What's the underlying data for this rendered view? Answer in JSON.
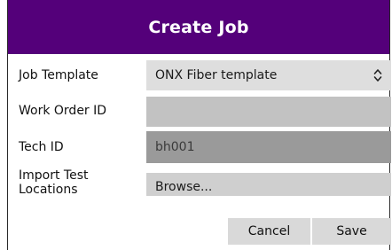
{
  "dialog": {
    "title": "Create Job"
  },
  "form": {
    "job_template": {
      "label": "Job Template",
      "value": "ONX Fiber template",
      "icon": "up-down-chevron-icon"
    },
    "work_order_id": {
      "label": "Work Order ID",
      "value": ""
    },
    "tech_id": {
      "label": "Tech ID",
      "value": "bh001"
    },
    "import_test_locations": {
      "label_line1": "Import Test",
      "label_line2": "Locations",
      "button_label": "Browse..."
    }
  },
  "actions": {
    "cancel_label": "Cancel",
    "save_label": "Save"
  },
  "colors": {
    "title_bar": "#54007a",
    "title_text": "#ffffff"
  }
}
